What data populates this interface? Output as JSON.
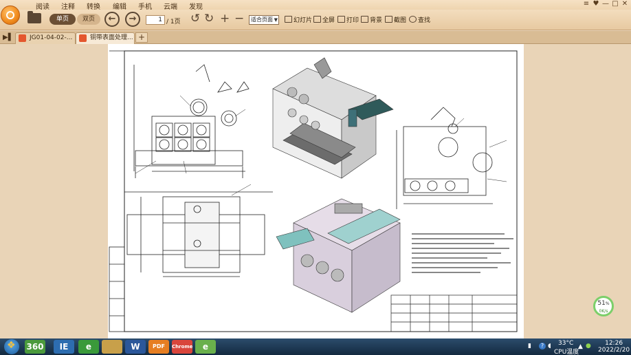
{
  "menu": {
    "items": [
      "阅读",
      "注释",
      "转换",
      "编辑",
      "手机",
      "云端",
      "发现"
    ],
    "window_controls": [
      "≡",
      "♥",
      "—",
      "□",
      "✕"
    ]
  },
  "toolbar": {
    "view_single": "单页",
    "view_double": "双页",
    "current_page": "1",
    "page_total": "/ 1页",
    "zoom": "适合页面",
    "slideshow": "幻灯片",
    "fullscreen": "全屏",
    "print": "打印",
    "background": "背景",
    "screenshot": "截图",
    "search": "查找"
  },
  "tabs": [
    {
      "label": "JG01-04-02-...",
      "active": false
    },
    {
      "label": "铜带表面处理...",
      "active": true
    }
  ],
  "tab_add": "+",
  "zoom_badge": {
    "percent": "51",
    "unit": "%",
    "note": "0K/s"
  },
  "taskbar": {
    "apps": [
      "360",
      "IE",
      "e",
      "W",
      "PDF",
      "Chrome",
      "e"
    ],
    "temperature": "33°C",
    "cpu_label": "CPU温度",
    "time": "12:26",
    "date": "2022/2/20"
  }
}
